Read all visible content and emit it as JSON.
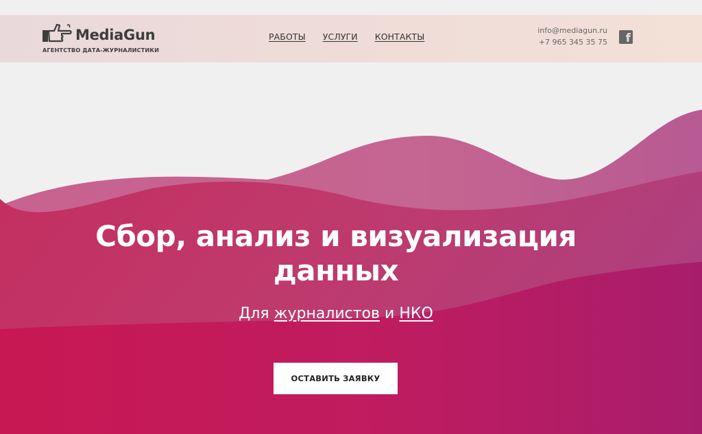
{
  "header": {
    "logo": {
      "name": "MediaGun",
      "tagline": "АГЕНТСТВО ДАТА-ЖУРНАЛИСТИКИ",
      "icon": "pointing-hand-icon"
    },
    "nav": [
      {
        "label": "РАБОТЫ"
      },
      {
        "label": "УСЛУГИ"
      },
      {
        "label": "КОНТАКТЫ"
      }
    ],
    "contacts": {
      "email": "info@mediagun.ru",
      "phone": "+7 965 345 35 75"
    },
    "social": {
      "icon": "facebook-icon"
    }
  },
  "hero": {
    "title_line1": "Сбор, анализ и визуализация",
    "title_line2": "данных",
    "subtitle_prefix": "Для",
    "subtitle_link1": "журналистов",
    "subtitle_middle": "и",
    "subtitle_link2": "НКО",
    "cta_label": "ОСТАВИТЬ ЗАЯВКУ"
  },
  "colors": {
    "background": "#f0f0f0",
    "wave_light": "#c8628f",
    "wave_mid": "#c23466",
    "wave_dark": "#b81f5b",
    "header_bg": "#ecdad9",
    "text_dark": "#3d3d3d"
  }
}
